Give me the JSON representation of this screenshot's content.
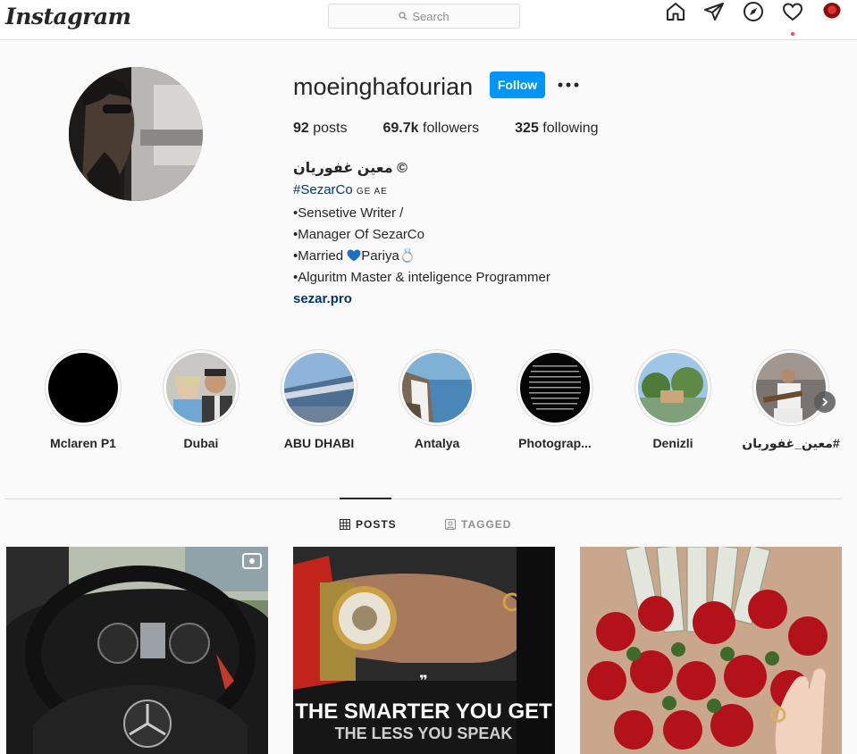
{
  "app": {
    "logo": "Instagram",
    "search_placeholder": "Search"
  },
  "nav": {
    "icons": [
      "home-icon",
      "direct-icon",
      "explore-icon",
      "activity-heart-icon",
      "profile-avatar-icon"
    ],
    "notification_dot_color": "#ed4956"
  },
  "profile": {
    "username": "moeinghafourian",
    "follow_label": "Follow",
    "more_label": "•••",
    "stats": {
      "posts_count": "92",
      "posts_label": "posts",
      "followers_count": "69.7k",
      "followers_label": "followers",
      "following_count": "325",
      "following_label": "following"
    },
    "bio": {
      "name": "معین غفوریان ©",
      "hashtag": "#SezarCo",
      "hashtag_suffix": "GE AE",
      "line1": "•Sensetive Writer /",
      "line2": "•Manager Of SezarCo",
      "line3_prefix": "•Married ",
      "line3_name": "Pariya",
      "line3_emoji": "💍",
      "line4": "•Alguritm Master & inteligence Programmer",
      "website": "sezar.pro"
    },
    "accent_color": "#0095f6"
  },
  "highlights": [
    {
      "label": "Mclaren P1"
    },
    {
      "label": "Dubai"
    },
    {
      "label": "ABU DHABI"
    },
    {
      "label": "Antalya"
    },
    {
      "label": "Photograp..."
    },
    {
      "label": "Denizli"
    },
    {
      "label": "#معین_غفوریان"
    }
  ],
  "tabs": {
    "posts_label": "POSTS",
    "tagged_label": "TAGGED"
  },
  "posts": {
    "post2_caption_line1": "THE SMARTER YOU GET",
    "post2_caption_line2": "THE LESS YOU SPEAK",
    "post2_quote_mark": "❞"
  }
}
